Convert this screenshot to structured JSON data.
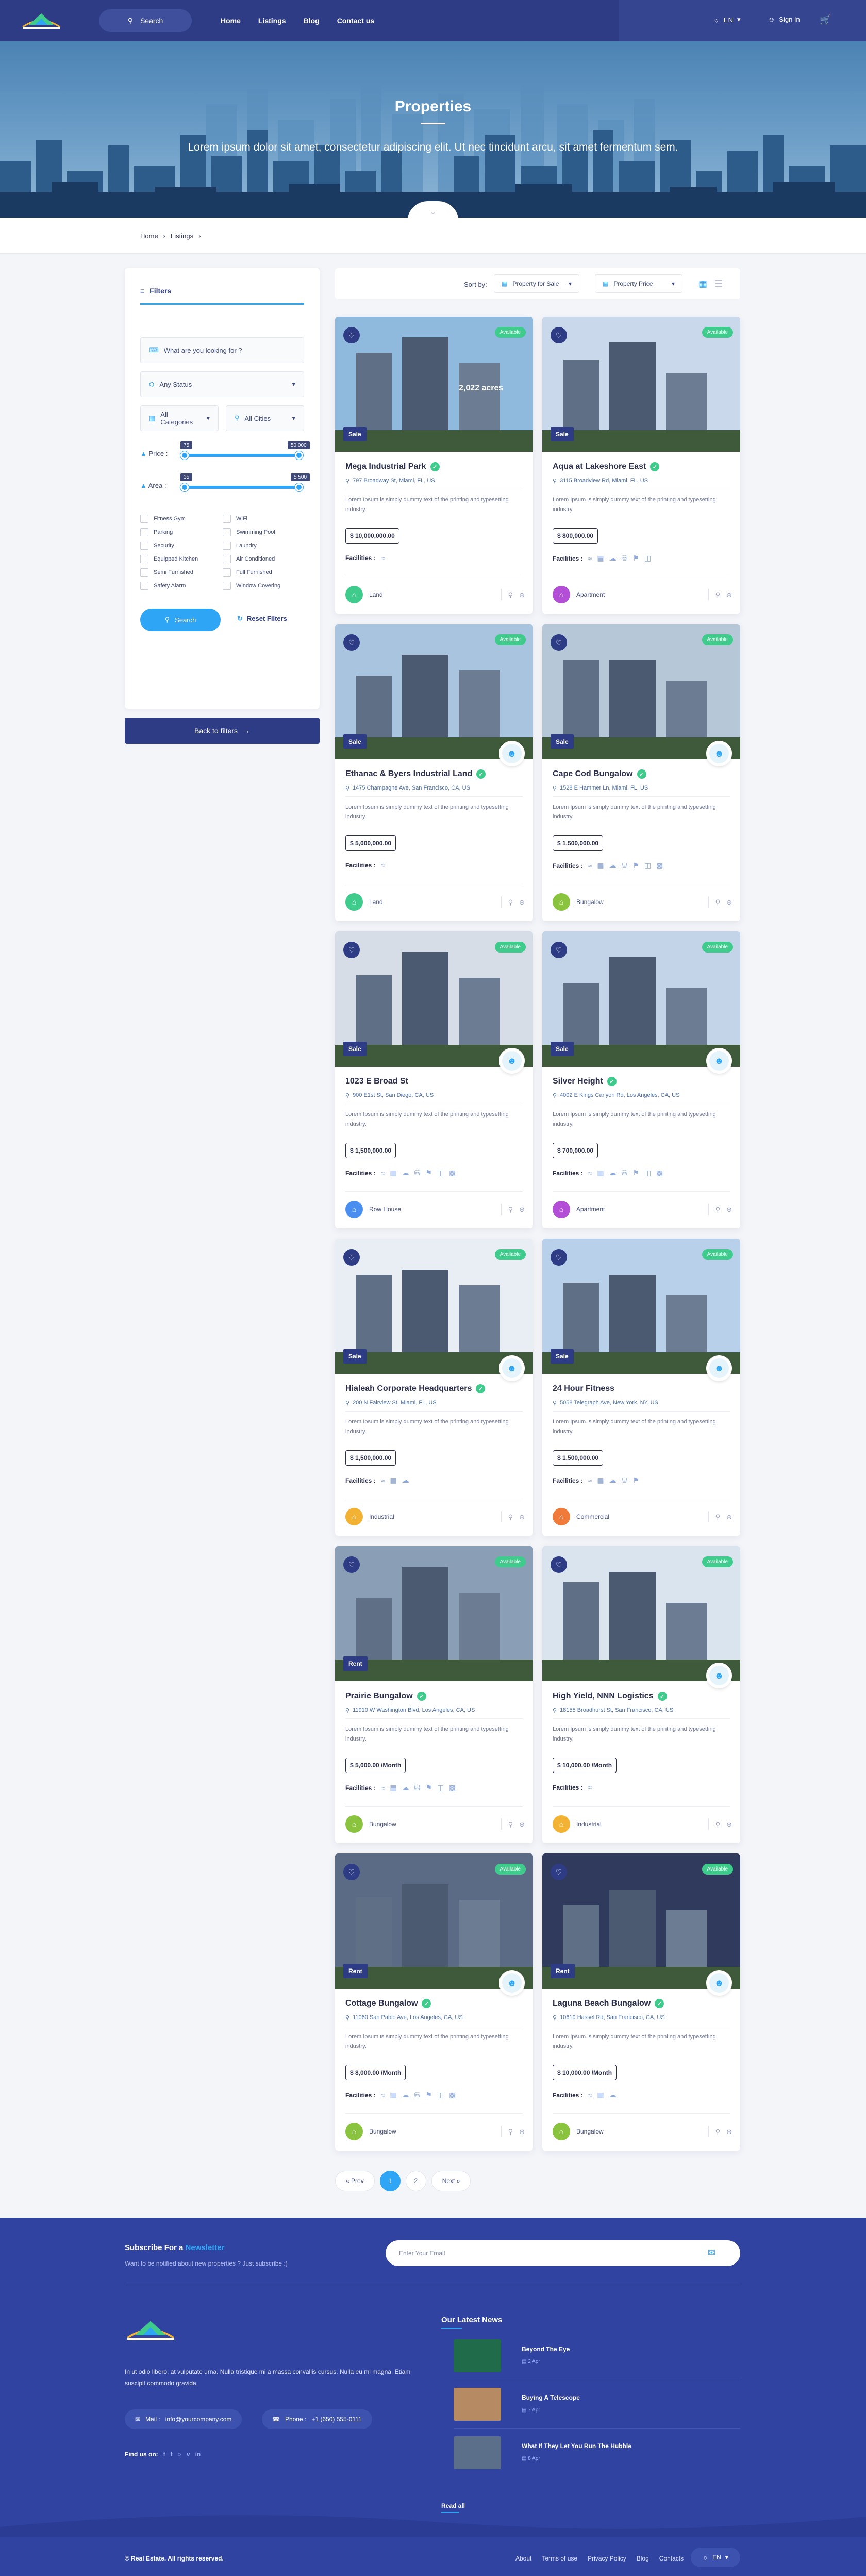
{
  "nav": {
    "search_label": "Search",
    "menu": [
      "Home",
      "Listings",
      "Blog",
      "Contact us"
    ],
    "lang": "EN",
    "sign_in": "Sign In",
    "cart_count": ""
  },
  "hero": {
    "title": "Properties",
    "subtitle": "Lorem ipsum dolor sit amet, consectetur adipiscing elit. Ut nec tincidunt arcu, sit amet fermentum sem."
  },
  "breadcrumb": [
    "Home",
    "Listings"
  ],
  "filters": {
    "tab": "Filters",
    "search_placeholder": "What are you looking for ?",
    "status": "Any Status",
    "categories": "All Categories",
    "cities": "All Cities",
    "price_label": "Price :",
    "price_min": "75",
    "price_max": "50 000",
    "area_label": "Area :",
    "area_min": "35",
    "area_max": "5 500",
    "amenities": [
      "Fitness Gym",
      "WiFi",
      "Parking",
      "Swimming Pool",
      "Security",
      "Laundry",
      "Equipped Kitchen",
      "Air Conditioned",
      "Semi Furnished",
      "Full Furnished",
      "Safety Alarm",
      "Window Covering"
    ],
    "search_btn": "Search",
    "reset_btn": "Reset Filters",
    "back_btn": "Back to filters"
  },
  "sort": {
    "label": "Sort by:",
    "option1": "Property for Sale",
    "option2": "Property Price"
  },
  "common": {
    "available": "Available",
    "description": "Lorem Ipsum is simply dummy text of the printing and typesetting industry.",
    "facilities": "Facilities :"
  },
  "properties": [
    {
      "name": "Mega Industrial Park",
      "address": "797 Broadway St, Miami, FL, US",
      "price": "$ 10,000,000.00",
      "tag": "Sale",
      "category": "Land",
      "cat_color": "#3fcb8c",
      "overlay": "2,022 acres",
      "fac_count": 1,
      "verified": true,
      "agent": false
    },
    {
      "name": "Aqua at Lakeshore East",
      "address": "3115 Broadview Rd, Miami, FL, US",
      "price": "$ 800,000.00",
      "tag": "Sale",
      "category": "Apartment",
      "cat_color": "#b34fd6",
      "overlay": "",
      "fac_count": 6,
      "verified": true,
      "agent": false
    },
    {
      "name": "Ethanac & Byers Industrial Land",
      "address": "1475 Champagne Ave, San Francisco, CA, US",
      "price": "$ 5,000,000.00",
      "tag": "Sale",
      "category": "Land",
      "cat_color": "#3fcb8c",
      "overlay": "",
      "fac_count": 1,
      "verified": true,
      "agent": true
    },
    {
      "name": "Cape Cod Bungalow",
      "address": "1528 E Hammer Ln, Miami, FL, US",
      "price": "$ 1,500,000.00",
      "tag": "Sale",
      "category": "Bungalow",
      "cat_color": "#8ac43f",
      "overlay": "",
      "fac_count": 7,
      "verified": true,
      "agent": true
    },
    {
      "name": "1023 E Broad St",
      "address": "900 E1st St, San Diego, CA, US",
      "price": "$ 1,500,000.00",
      "tag": "Sale",
      "category": "Row House",
      "cat_color": "#4a8ef0",
      "overlay": "",
      "fac_count": 7,
      "verified": false,
      "agent": true
    },
    {
      "name": "Silver Height",
      "address": "4002 E Kings Canyon Rd, Los Angeles, CA, US",
      "price": "$ 700,000.00",
      "tag": "Sale",
      "category": "Apartment",
      "cat_color": "#b34fd6",
      "overlay": "",
      "fac_count": 7,
      "verified": true,
      "agent": true
    },
    {
      "name": "Hialeah Corporate Headquarters",
      "address": "200 N Fairview St, Miami, FL, US",
      "price": "$ 1,500,000.00",
      "tag": "Sale",
      "category": "Industrial",
      "cat_color": "#f2b233",
      "overlay": "",
      "fac_count": 3,
      "verified": true,
      "agent": true
    },
    {
      "name": "24 Hour Fitness",
      "address": "5058 Telegraph Ave, New York, NY, US",
      "price": "$ 1,500,000.00",
      "tag": "Sale",
      "category": "Commercial",
      "cat_color": "#f07a3a",
      "overlay": "",
      "fac_count": 5,
      "verified": false,
      "agent": true
    },
    {
      "name": "Prairie Bungalow",
      "address": "11910 W Washington Blvd, Los Angeles, CA, US",
      "price": "$ 5,000.00 /Month",
      "tag": "Rent",
      "category": "Bungalow",
      "cat_color": "#8ac43f",
      "overlay": "",
      "fac_count": 7,
      "verified": true,
      "agent": false
    },
    {
      "name": "High Yield, NNN Logistics",
      "address": "18155 Broadhurst St, San Francisco, CA, US",
      "price": "$ 10,000.00 /Month",
      "tag": "",
      "category": "Industrial",
      "cat_color": "#f2b233",
      "overlay": "",
      "fac_count": 1,
      "verified": true,
      "agent": true
    },
    {
      "name": "Cottage Bungalow",
      "address": "11060 San Pablo Ave, Los Angeles, CA, US",
      "price": "$ 8,000.00 /Month",
      "tag": "Rent",
      "category": "Bungalow",
      "cat_color": "#8ac43f",
      "overlay": "",
      "fac_count": 7,
      "verified": true,
      "agent": true
    },
    {
      "name": "Laguna Beach Bungalow",
      "address": "10619 Hassel Rd, San Francisco, CA, US",
      "price": "$ 10,000.00 /Month",
      "tag": "Rent",
      "category": "Bungalow",
      "cat_color": "#8ac43f",
      "overlay": "",
      "fac_count": 3,
      "verified": true,
      "agent": true
    }
  ],
  "pagination": {
    "prev": "Prev",
    "pages": [
      "1",
      "2"
    ],
    "next": "Next"
  },
  "footer": {
    "subscribe_title": "Subscribe For a",
    "subscribe_highlight": "Newsletter",
    "subscribe_text": "Want to be notified about new properties ? Just subscribe :)",
    "email_placeholder": "Enter Your Email",
    "about": "In ut odio libero, at vulputate urna. Nulla tristique mi a massa convallis cursus. Nulla eu mi magna. Etiam suscipit commodo gravida.",
    "mail_label": "Mail :",
    "mail": "info@yourcompany.com",
    "phone_label": "Phone :",
    "phone": "+1 (650) 555-0111",
    "find_us": "Find us on:",
    "news_title": "Our Latest News",
    "news": [
      {
        "title": "Beyond The Eye",
        "date": "2 Apr"
      },
      {
        "title": "Buying A Telescope",
        "date": "7 Apr"
      },
      {
        "title": "What If They Let You Run The Hubble",
        "date": "8 Apr"
      }
    ],
    "read_all": "Read all",
    "copyright": "© Real Estate. All rights reserved.",
    "links": [
      "About",
      "Terms of use",
      "Privacy Policy",
      "Blog",
      "Contacts"
    ],
    "lang": "EN"
  }
}
